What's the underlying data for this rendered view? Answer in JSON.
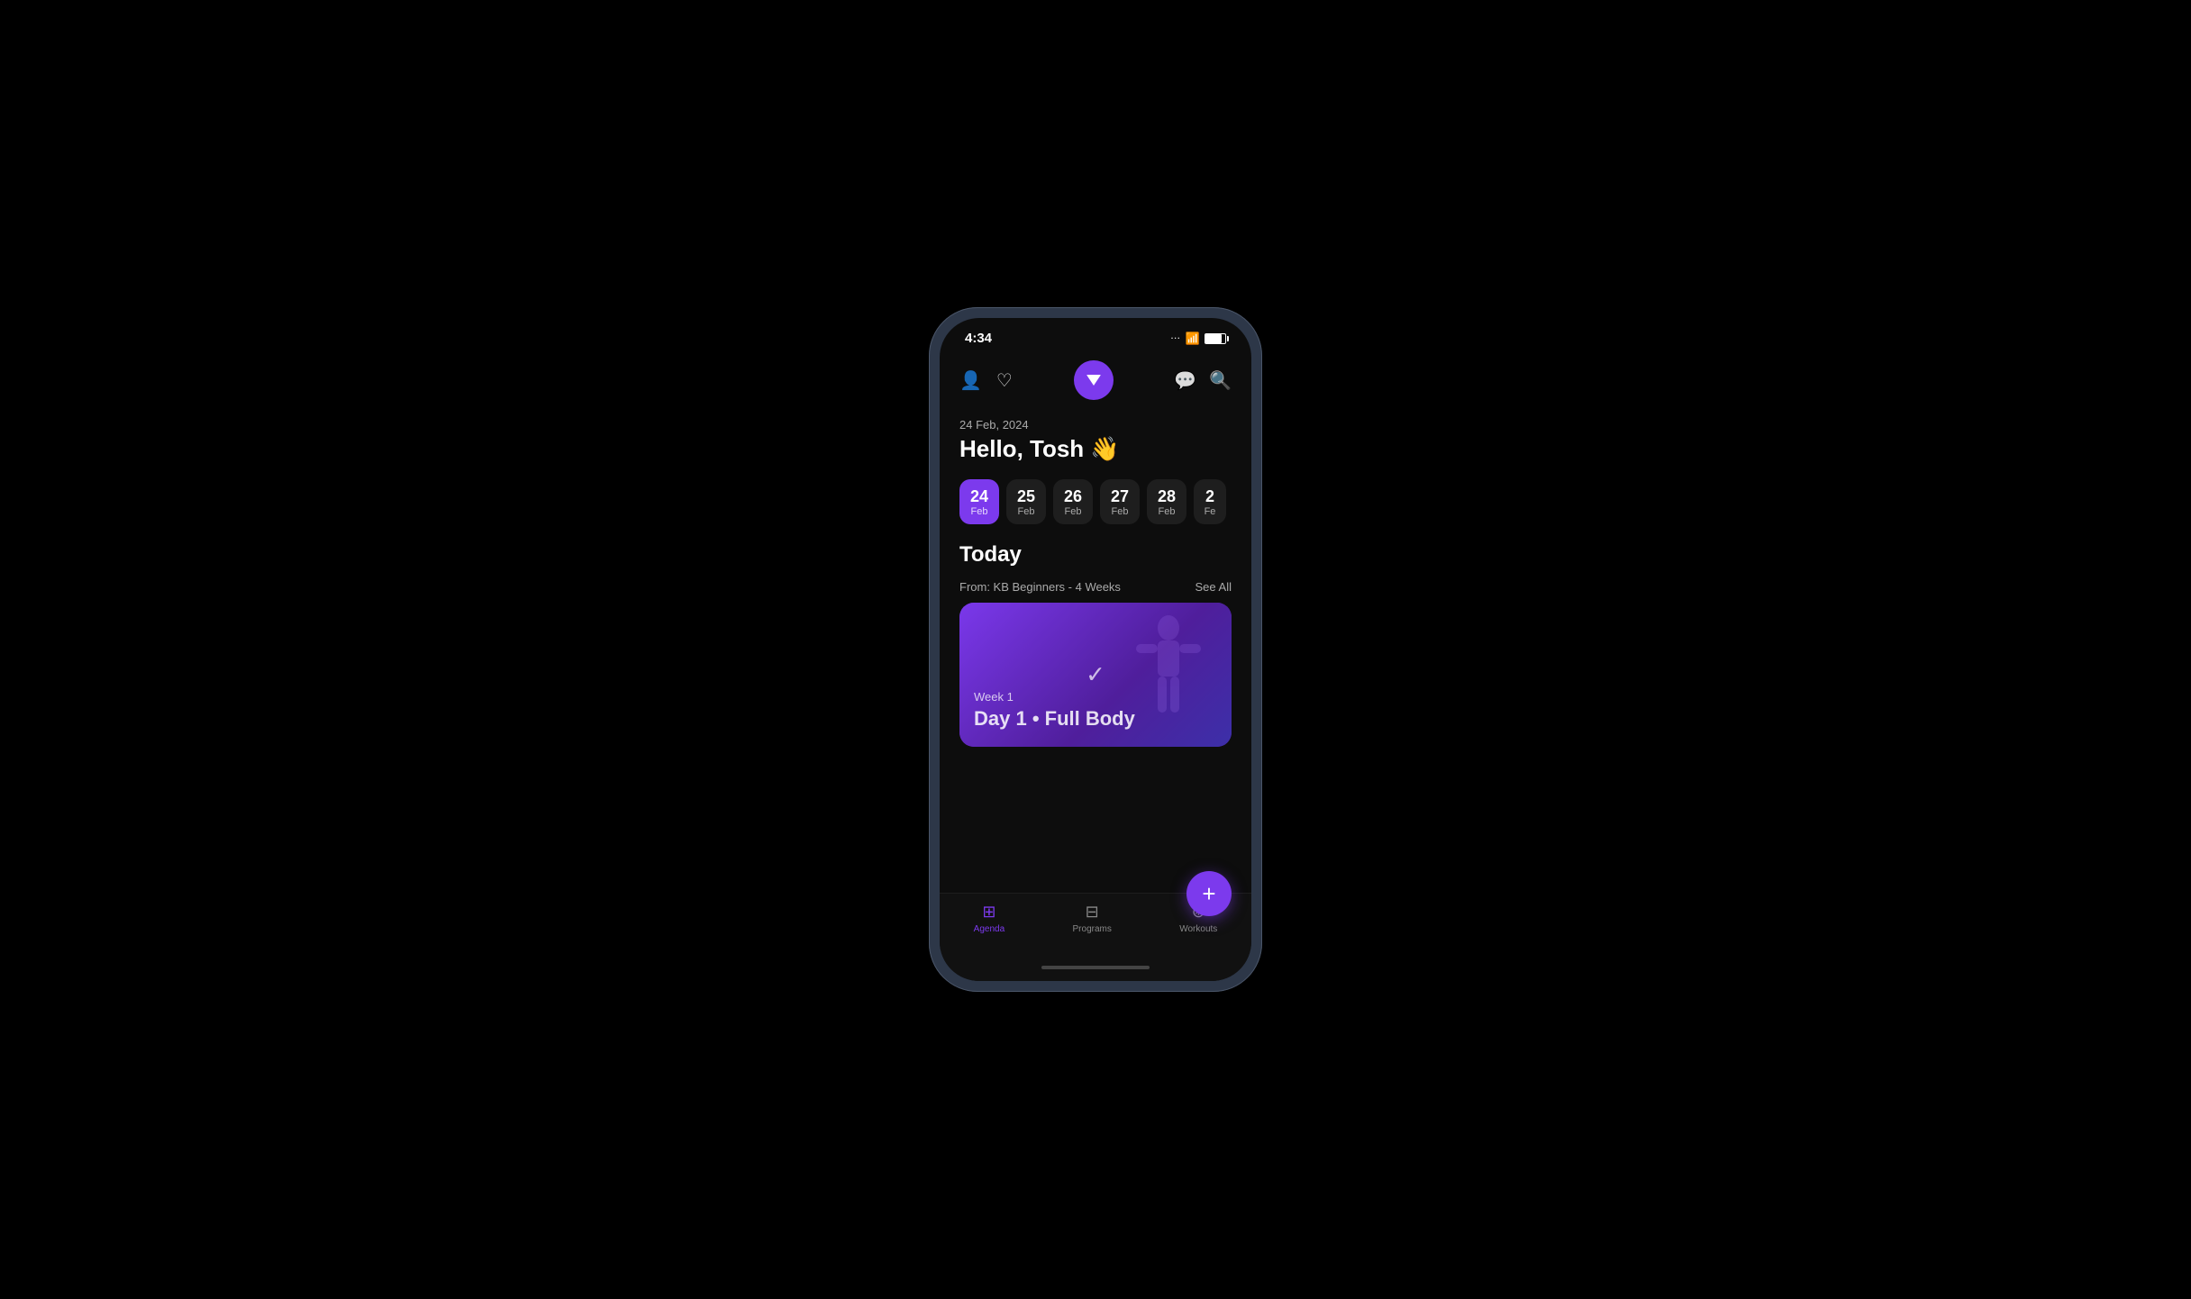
{
  "statusBar": {
    "time": "4:34",
    "icons": [
      "···",
      "wifi",
      "battery"
    ]
  },
  "header": {
    "logo": "▼",
    "navLeft": [
      "person-icon",
      "heart-icon"
    ],
    "navRight": [
      "chat-icon",
      "search-icon"
    ]
  },
  "greeting": {
    "date": "24 Feb, 2024",
    "text": "Hello, Tosh 👋"
  },
  "calendar": {
    "days": [
      {
        "num": "24",
        "month": "Feb",
        "active": true
      },
      {
        "num": "25",
        "month": "Feb",
        "active": false
      },
      {
        "num": "26",
        "month": "Feb",
        "active": false
      },
      {
        "num": "27",
        "month": "Feb",
        "active": false
      },
      {
        "num": "28",
        "month": "Feb",
        "active": false
      },
      {
        "num": "2",
        "month": "Fe",
        "active": false,
        "partial": true
      }
    ]
  },
  "today": {
    "label": "Today",
    "sectionFrom": "From: KB Beginners - 4 Weeks",
    "seeAll": "See All",
    "workoutCard": {
      "week": "Week 1",
      "title": "Day 1 • Full Body"
    }
  },
  "fab": {
    "label": "+"
  },
  "bottomNav": {
    "items": [
      {
        "id": "agenda",
        "label": "Agenda",
        "icon": "⊞",
        "active": true
      },
      {
        "id": "programs",
        "label": "Programs",
        "icon": "⊟",
        "active": false
      },
      {
        "id": "workouts",
        "label": "Workouts",
        "icon": "⊛",
        "active": false
      }
    ]
  }
}
